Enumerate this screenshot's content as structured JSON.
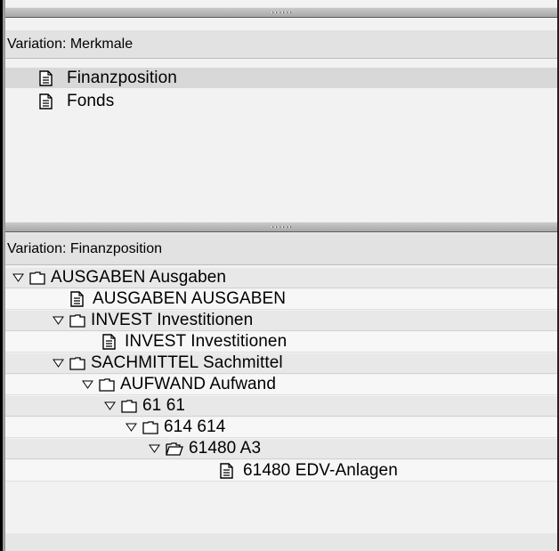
{
  "top_pane": {
    "header": "Variation: Merkmale",
    "items": [
      {
        "label": "Finanzposition",
        "icon": "document-icon",
        "selected": true
      },
      {
        "label": "Fonds",
        "icon": "document-icon",
        "selected": false
      }
    ]
  },
  "bottom_pane": {
    "header": "Variation: Finanzposition",
    "tree": [
      {
        "label": "AUSGABEN Ausgaben",
        "type": "folder",
        "expanded": true,
        "level": 0
      },
      {
        "label": "AUSGABEN AUSGABEN",
        "type": "document",
        "level": 1
      },
      {
        "label": "INVEST Investitionen",
        "type": "folder",
        "expanded": true,
        "level": 1
      },
      {
        "label": "INVEST Investitionen",
        "type": "document",
        "level": 2
      },
      {
        "label": "SACHMITTEL Sachmittel",
        "type": "folder",
        "expanded": true,
        "level": 1
      },
      {
        "label": "AUFWAND Aufwand",
        "type": "folder",
        "expanded": true,
        "level": 2
      },
      {
        "label": "61 61",
        "type": "folder",
        "expanded": true,
        "level": 3
      },
      {
        "label": "614 614",
        "type": "folder",
        "expanded": true,
        "level": 4
      },
      {
        "label": "61480 A3",
        "type": "folder-open",
        "expanded": true,
        "level": 5
      },
      {
        "label": "61480 EDV-Anlagen",
        "type": "document",
        "level": 6
      }
    ]
  },
  "colors": {
    "header_bg": "#e2e2e2",
    "selected_row_bg": "#d8d8d8",
    "splitter_bg": "#b5b5b5",
    "frame_border": "#000000"
  }
}
